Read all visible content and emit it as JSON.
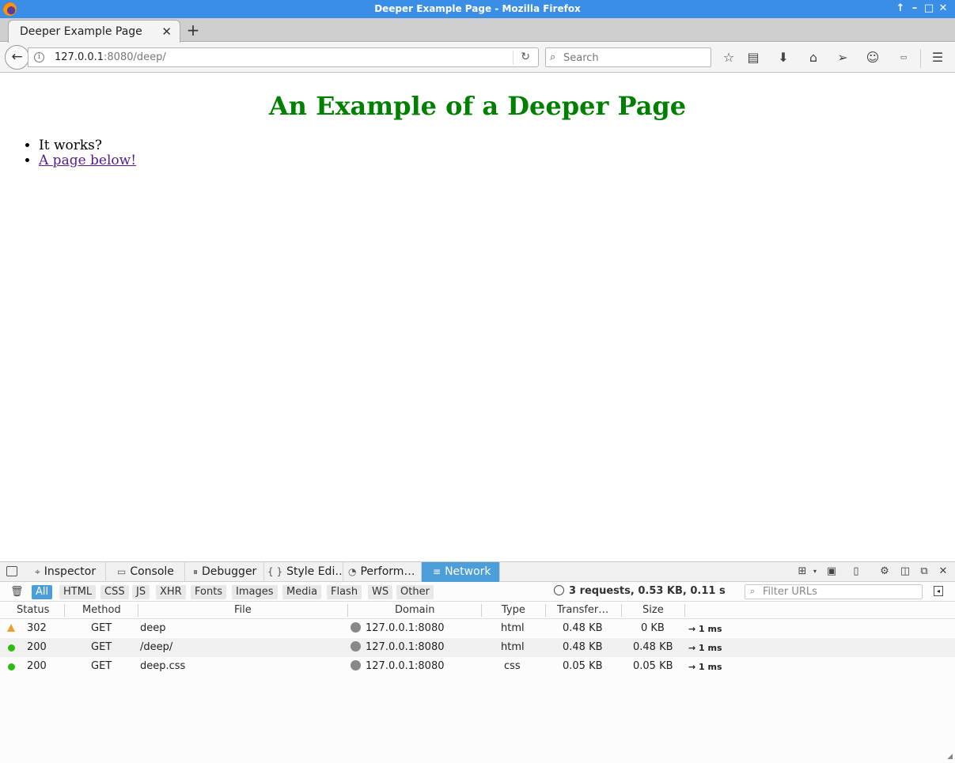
{
  "window": {
    "title": "Deeper Example Page - Mozilla Firefox"
  },
  "tabs": [
    {
      "label": "Deeper Example Page"
    }
  ],
  "urlbar": {
    "host": "127.0.0.1",
    "rest": ":8080/deep/"
  },
  "search": {
    "placeholder": "Search"
  },
  "page": {
    "heading": "An Example of a Deeper Page",
    "items": [
      {
        "text": "It works?"
      },
      {
        "text": "A page below!"
      }
    ],
    "heading_color": "#008000",
    "link_color": "#551a8b"
  },
  "devtools": {
    "tabs": {
      "inspector": "Inspector",
      "console": "Console",
      "debugger": "Debugger",
      "style_editor": "Style Edi…",
      "performance": "Perform…",
      "network": "Network"
    },
    "filters": [
      "All",
      "HTML",
      "CSS",
      "JS",
      "XHR",
      "Fonts",
      "Images",
      "Media",
      "Flash",
      "WS",
      "Other"
    ],
    "summary": "3 requests, 0.53 KB, 0.11 s",
    "filter_placeholder": "Filter URLs",
    "columns": {
      "status": "Status",
      "method": "Method",
      "file": "File",
      "domain": "Domain",
      "type": "Type",
      "transferred": "Transfer…",
      "size": "Size"
    },
    "requests": [
      {
        "status": "302",
        "method": "GET",
        "file": "deep",
        "domain": "127.0.0.1:8080",
        "type": "html",
        "transferred": "0.48 KB",
        "size": "0 KB",
        "timing": "→ 1 ms"
      },
      {
        "status": "200",
        "method": "GET",
        "file": "/deep/",
        "domain": "127.0.0.1:8080",
        "type": "html",
        "transferred": "0.48 KB",
        "size": "0.48 KB",
        "timing": "→ 1 ms"
      },
      {
        "status": "200",
        "method": "GET",
        "file": "deep.css",
        "domain": "127.0.0.1:8080",
        "type": "css",
        "transferred": "0.05 KB",
        "size": "0.05 KB",
        "timing": "→ 1 ms"
      }
    ],
    "accent_color": "#4c9ed9"
  }
}
